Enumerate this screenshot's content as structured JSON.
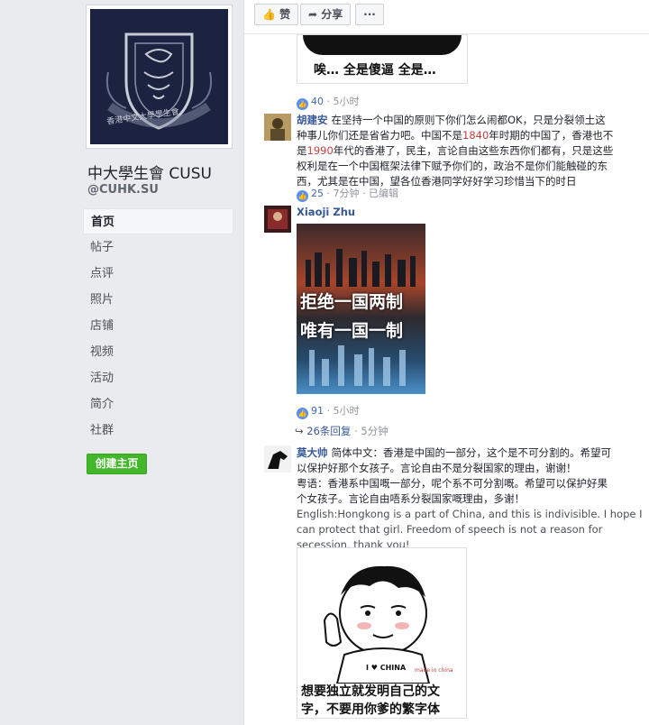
{
  "sidebar": {
    "page_name": "中大學生會 CUSU",
    "handle": "@CUHK.SU",
    "nav": [
      "首页",
      "帖子",
      "点评",
      "照片",
      "店铺",
      "视频",
      "活动",
      "简介",
      "社群"
    ],
    "create_button": "创建主页",
    "logo_text": "香港中文大學學生會"
  },
  "toolbar": {
    "like_label": "赞",
    "share_label": "分享",
    "more_label": "···"
  },
  "post_top": {
    "meme_caption": "唉… 全是傻逼 全是…",
    "likes": "40",
    "time": "5小时"
  },
  "comment1": {
    "author": "胡建安",
    "lines": [
      {
        "a": "在坚持一个中国的原则下你们怎么闹都OK，只是分裂领土这",
        "b": "",
        "c": ""
      },
      {
        "a": "种事儿你们还是省省力吧。中国不是",
        "b": "1840",
        "c": "年时期的中国了，香港也不"
      },
      {
        "a": "是",
        "b": "1990",
        "c": "年代的香港了，民主，言论自由这些东西你们都有，只是这些"
      },
      {
        "a": "权利是在一个中国框架法律下赋予你们的，政治不是你们能触碰的东",
        "b": "",
        "c": ""
      },
      {
        "a": "西，尤其是在中国，望各位香港同学好好学习珍惜当下的时日",
        "b": "",
        "c": ""
      }
    ],
    "likes": "25",
    "time": "7分钟",
    "edited": "已编辑"
  },
  "comment2": {
    "author": "Xiaoji Zhu",
    "image_text_line1": "拒绝一国两制",
    "image_text_line2": "唯有一国一制",
    "likes": "91",
    "time": "5小时",
    "replies": "26条回复",
    "replies_time": "5分钟"
  },
  "comment3": {
    "author": "莫大帅",
    "zh_lines": [
      "简体中文：香港是中国的一部分，这个是不可分割的。希望可",
      "以保护好那个女孩子。言论自由不是分裂国家的理由，谢谢！",
      "粤语：香港系中国嘅一部分，呢个系不可分割嘅。希望可以保护好果",
      "个女孩子。言论自由唔系分裂国家嘅理由，多谢！"
    ],
    "en_lines": [
      "English:Hongkong is a part of China, and this is indivisible. I hope I",
      "can protect that girl. Freedom of speech is not a reason for",
      "secession, thank you!"
    ],
    "meme_caption_line1": "想要独立就发明自己的文",
    "meme_caption_line2": "字，不要用你爹的繁字体",
    "shirt_text": "I ♥ CHINA",
    "made_in": "made in china"
  },
  "colors": {
    "link": "#365899",
    "accent_red": "#c43e3e",
    "green_button": "#42b72a",
    "like_blue": "#5890ff"
  }
}
